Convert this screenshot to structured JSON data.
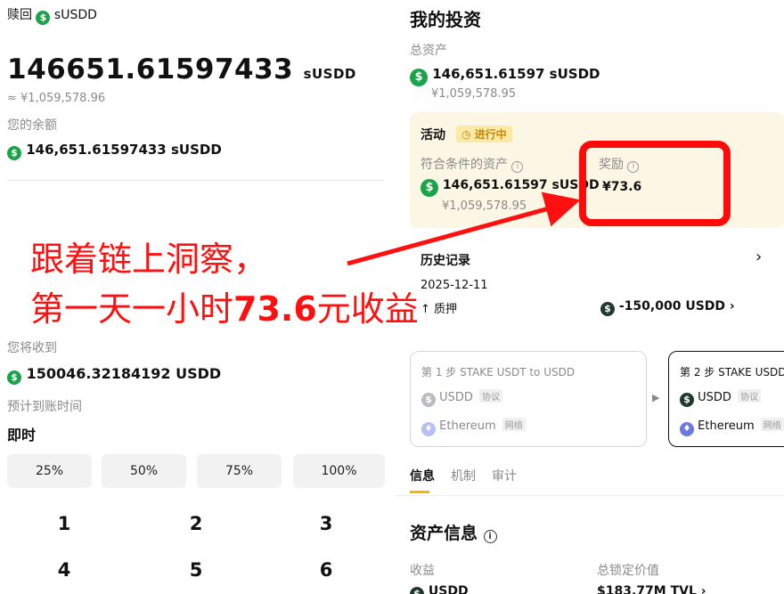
{
  "left": {
    "redeem_label": "赎回",
    "redeem_token": "sUSDD",
    "amount": "146651.61597433",
    "amount_unit": "sUSDD",
    "approx_cny": "≈ ¥1,059,578.96",
    "balance_label": "您的余额",
    "balance_value": "146,651.61597433 sUSDD",
    "receive_label": "您将收到",
    "receive_value": "150046.32184192 USDD",
    "eta_label": "预计到账时间",
    "eta_value": "即时",
    "percent_buttons": [
      "25%",
      "50%",
      "75%",
      "100%"
    ],
    "keypad": [
      "1",
      "2",
      "3",
      "4",
      "5",
      "6"
    ]
  },
  "right": {
    "title": "我的投资",
    "total_label": "总资产",
    "total_value": "146,651.61597 sUSDD",
    "total_cny": "¥1,059,578.95",
    "activity": {
      "title": "活动",
      "status": "进行中",
      "eligible_label": "符合条件的资产",
      "eligible_value": "146,651.61597 sUSDD",
      "eligible_cny": "¥1,059,578.95",
      "reward_label": "奖励",
      "reward_value": "¥73.6"
    },
    "history": {
      "title": "历史记录",
      "date": "2025-12-11",
      "type": "质押",
      "amount": "-150,000 USDD"
    },
    "step1": {
      "title": "第 1 步 STAKE USDT to USDD",
      "token": "USDD",
      "token_tag": "协议",
      "network": "Ethereum",
      "network_tag": "网络"
    },
    "step2": {
      "title": "第 2 步 STAKE USDD",
      "token": "USDD",
      "token_tag": "协议",
      "network": "Ethereum",
      "network_tag": "网络"
    },
    "tabs": [
      "信息",
      "机制",
      "审计"
    ],
    "asset_info": {
      "title": "资产信息",
      "yield_label": "收益",
      "tvl_label": "总锁定价值",
      "yield_value": "USDD",
      "tvl_value": "$183.77M TVL"
    }
  },
  "overlay": {
    "line1": "跟着链上洞察，",
    "line2_prefix": "第一天一小时",
    "line2_number": "73.6",
    "line2_suffix": "元收益",
    "color": "#ff1010"
  },
  "colors": {
    "accent": "#f5b700",
    "coin": "#1aa34a",
    "activity_bg": "#fcf6e4",
    "highlight": "#ff0a0a"
  }
}
